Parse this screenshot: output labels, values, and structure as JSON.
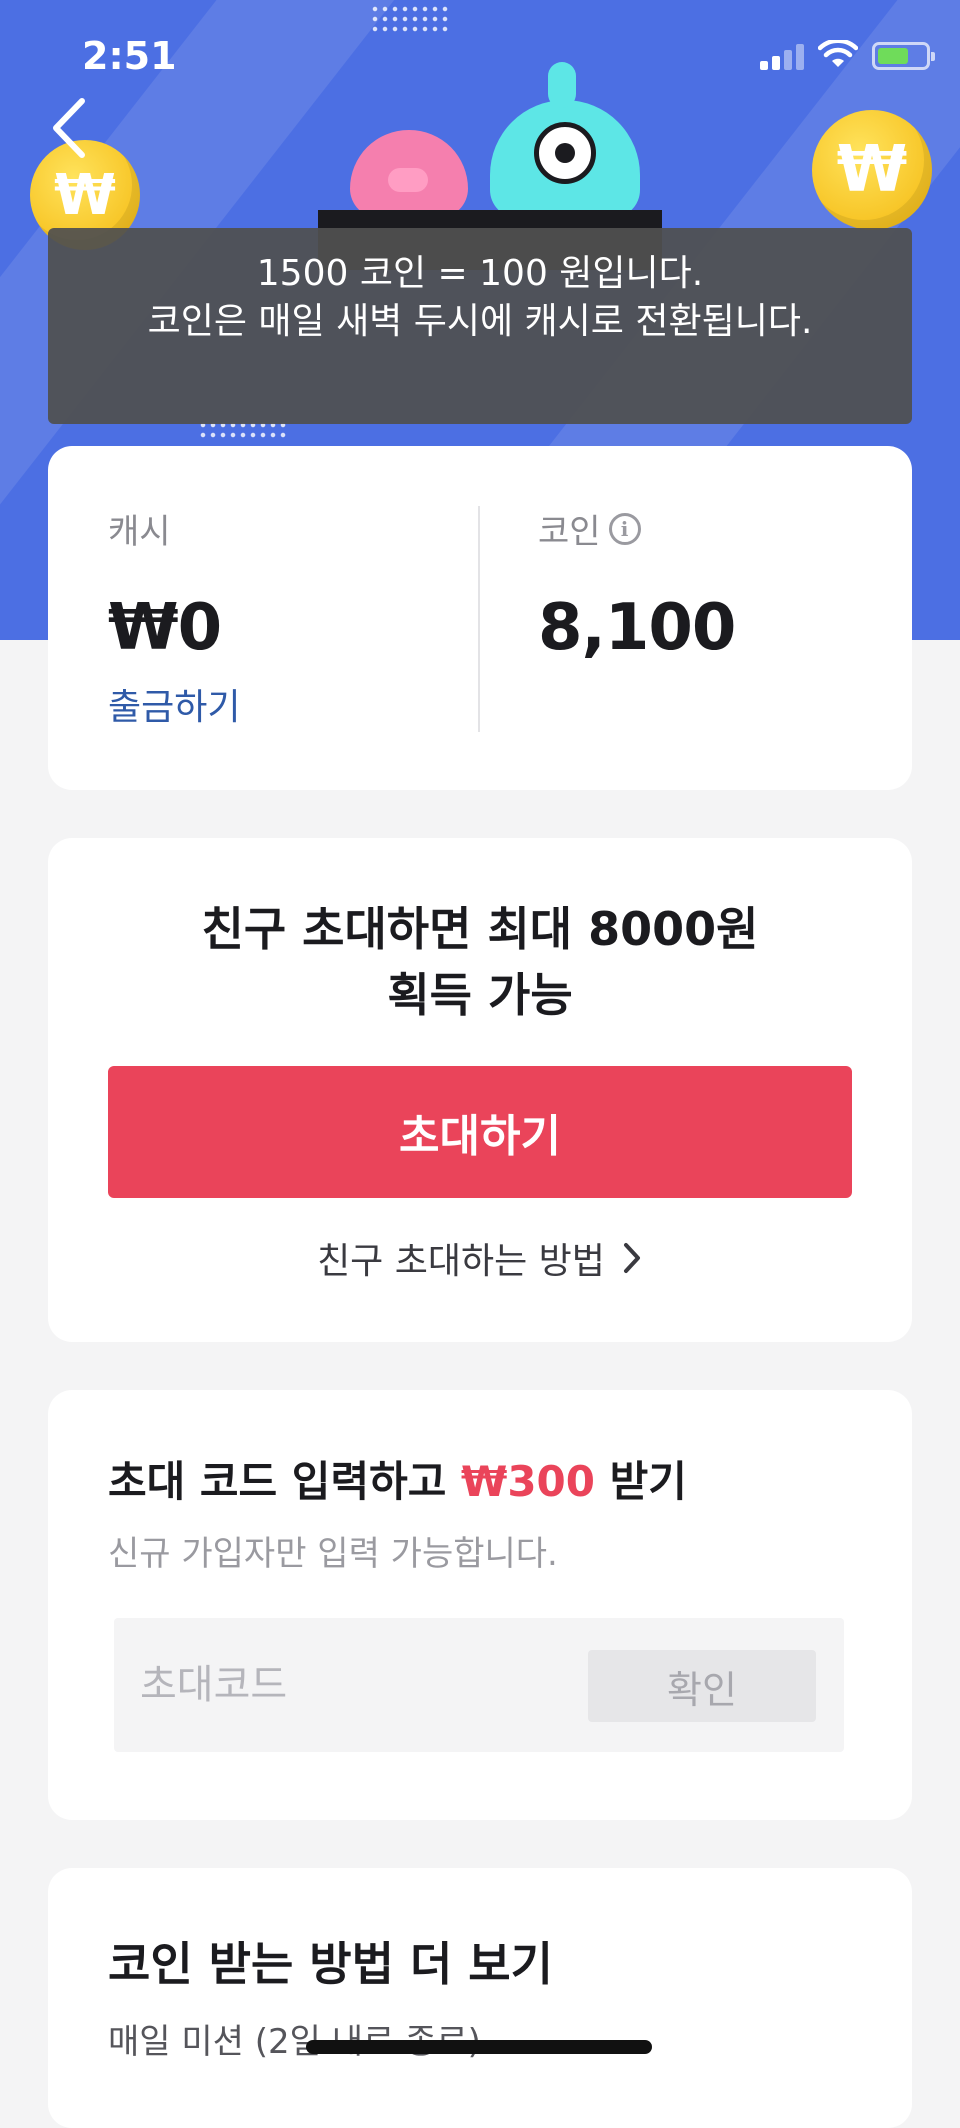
{
  "status_bar": {
    "time": "2:51"
  },
  "banner": {
    "coin_symbol": "₩",
    "tooltip": {
      "line1": "1500 코인 = 100 원입니다.",
      "line2": "코인은 매일 새벽 두시에 캐시로 전환됩니다."
    }
  },
  "balance": {
    "cash_label": "캐시",
    "cash_value": "₩0",
    "withdraw_label": "출금하기",
    "coin_label": "코인",
    "coin_value": "8,100"
  },
  "invite": {
    "title_line1": "친구 초대하면 최대 8000원",
    "title_line2": "획득 가능",
    "button_label": "초대하기",
    "howto_label": "친구 초대하는 방법"
  },
  "invite_code": {
    "title_prefix": "초대 코드 입력하고 ",
    "title_amount": "₩300",
    "title_suffix": " 받기",
    "subtitle": "신규 가입자만 입력 가능합니다.",
    "input_placeholder": "초대코드",
    "input_value": "",
    "confirm_label": "확인"
  },
  "more_ways": {
    "title": "코인 받는 방법 더 보기",
    "subtitle": "매일 미션 (2일 내로 종료)"
  },
  "colors": {
    "banner_blue": "#4c6fe3",
    "accent_red": "#ea445a",
    "link_blue": "#2f5aa8"
  },
  "icons": [
    "back-arrow-icon",
    "info-icon",
    "chevron-right-icon",
    "wifi-icon",
    "battery-icon",
    "signal-icon"
  ]
}
